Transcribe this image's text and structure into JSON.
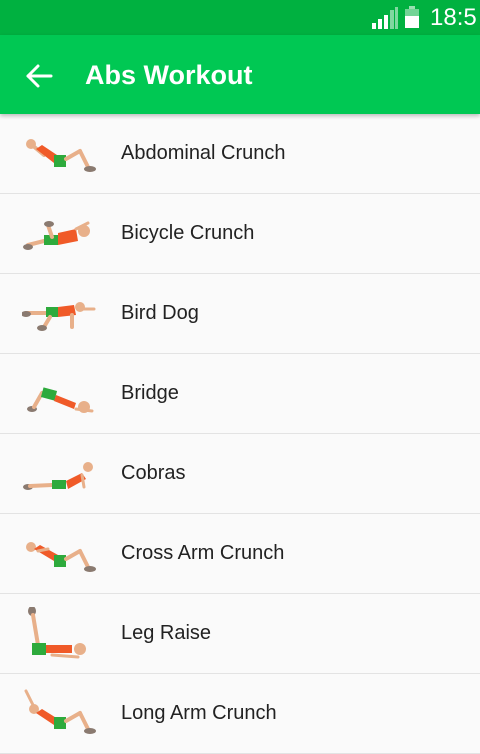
{
  "status_bar": {
    "time": "18:5",
    "signal_icon": "cell-signal-icon",
    "battery_icon": "battery-icon"
  },
  "app_bar": {
    "title": "Abs Workout",
    "back_icon": "arrow-back-icon",
    "color": "#00c853"
  },
  "exercises": [
    {
      "label": "Abdominal Crunch",
      "icon": "abdominal-crunch-figure"
    },
    {
      "label": "Bicycle Crunch",
      "icon": "bicycle-crunch-figure"
    },
    {
      "label": "Bird Dog",
      "icon": "bird-dog-figure"
    },
    {
      "label": "Bridge",
      "icon": "bridge-figure"
    },
    {
      "label": "Cobras",
      "icon": "cobras-figure"
    },
    {
      "label": "Cross Arm Crunch",
      "icon": "cross-arm-crunch-figure"
    },
    {
      "label": "Leg Raise",
      "icon": "leg-raise-figure"
    },
    {
      "label": "Long Arm Crunch",
      "icon": "long-arm-crunch-figure"
    }
  ]
}
